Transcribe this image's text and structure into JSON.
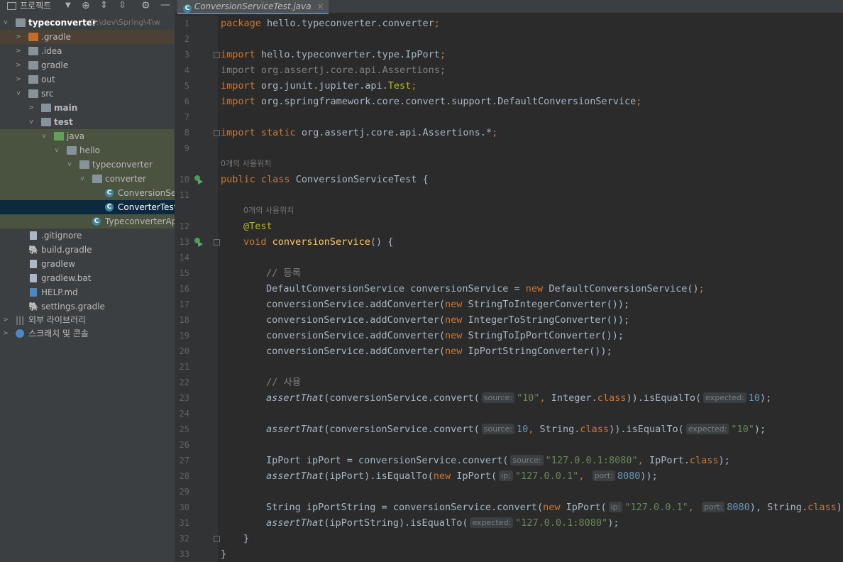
{
  "toolbar": {
    "project_label": "프로젝트"
  },
  "tab": {
    "label": "ConversionServiceTest.java"
  },
  "tree": [
    {
      "label": "typeconverter",
      "path": "D:\\dev\\Spring\\4\\w",
      "depth": 0,
      "arrow": "v",
      "icon": "module"
    },
    {
      "label": ".gradle",
      "depth": 1,
      "arrow": ">",
      "icon": "folder-orange"
    },
    {
      "label": ".idea",
      "depth": 1,
      "arrow": ">",
      "icon": "folder"
    },
    {
      "label": "gradle",
      "depth": 1,
      "arrow": ">",
      "icon": "folder"
    },
    {
      "label": "out",
      "depth": 1,
      "arrow": ">",
      "icon": "folder"
    },
    {
      "label": "src",
      "depth": 1,
      "arrow": "v",
      "icon": "folder"
    },
    {
      "label": "main",
      "depth": 2,
      "arrow": ">",
      "icon": "folder"
    },
    {
      "label": "test",
      "depth": 2,
      "arrow": "v",
      "icon": "folder"
    },
    {
      "label": "java",
      "depth": 3,
      "arrow": "v",
      "icon": "folder-green"
    },
    {
      "label": "hello",
      "depth": 4,
      "arrow": "v",
      "icon": "package"
    },
    {
      "label": "typeconverter",
      "depth": 5,
      "arrow": "v",
      "icon": "package"
    },
    {
      "label": "converter",
      "depth": 6,
      "arrow": "v",
      "icon": "package"
    },
    {
      "label": "ConversionServ",
      "depth": 7,
      "arrow": "",
      "icon": "class"
    },
    {
      "label": "ConverterTest",
      "depth": 7,
      "arrow": "",
      "icon": "class"
    },
    {
      "label": "TypeconverterApp",
      "depth": 6,
      "arrow": "",
      "icon": "class"
    },
    {
      "label": ".gitignore",
      "depth": 1,
      "arrow": "",
      "icon": "file"
    },
    {
      "label": "build.gradle",
      "depth": 1,
      "arrow": "",
      "icon": "gradle-file"
    },
    {
      "label": "gradlew",
      "depth": 1,
      "arrow": "",
      "icon": "file"
    },
    {
      "label": "gradlew.bat",
      "depth": 1,
      "arrow": "",
      "icon": "file"
    },
    {
      "label": "HELP.md",
      "depth": 1,
      "arrow": "",
      "icon": "md-file"
    },
    {
      "label": "settings.gradle",
      "depth": 1,
      "arrow": "",
      "icon": "gradle-file"
    },
    {
      "label": "외부 라이브러리",
      "depth": 0,
      "arrow": ">",
      "icon": "library"
    },
    {
      "label": "스크래치 및 콘솔",
      "depth": 0,
      "arrow": ">",
      "icon": "scratch"
    }
  ],
  "hints": {
    "usages": "0개의 사용위치",
    "source": "source:",
    "expected": "expected:",
    "ip": "ip:",
    "port": "port:"
  },
  "code": {
    "line_numbers": [
      "1",
      "2",
      "3",
      "4",
      "5",
      "6",
      "7",
      "8",
      "9",
      "10",
      "11",
      "12",
      "13",
      "14",
      "15",
      "16",
      "17",
      "18",
      "19",
      "20",
      "21",
      "22",
      "23",
      "24",
      "25",
      "26",
      "27",
      "28",
      "29",
      "30",
      "31",
      "32",
      "33"
    ],
    "kw_package": "package",
    "pkg_name": "hello.typeconverter.converter",
    "kw_import": "import",
    "kw_static": "static",
    "imp_ipport": "hello.typeconverter.type.IpPort",
    "imp_assertions": "org.assertj.core.api.Assertions",
    "imp_junit": "org.junit.jupiter.api.",
    "imp_test": "Test",
    "imp_dcs": "org.springframework.core.convert.support.DefaultConversionService",
    "imp_static": "org.assertj.core.api.Assertions.*",
    "kw_public": "public",
    "kw_class": "class",
    "cls_name": "ConversionServiceTest",
    "ann_test": "@Test",
    "kw_void": "void",
    "method_name": "conversionService",
    "cmt_register": "// 등록",
    "dcs_type": "DefaultConversionService",
    "var_cs": "conversionService",
    "kw_new": "new",
    "dcs_ctor": "DefaultConversionService()",
    "add_conv": "conversionService.addConverter(",
    "conv_1": "StringToIntegerConverter());",
    "conv_2": "IntegerToStringConverter());",
    "conv_3": "StringToIpPortConverter());",
    "conv_4": "IpPortStringConverter());",
    "cmt_use": "// 사용",
    "fn_assert": "assertThat",
    "cs_convert": "(conversionService.convert(",
    "cs_convert2": "conversionService.convert(",
    "str_10": "\"10\"",
    "num_10": "10",
    "integer_cls": "Integer.",
    "string_cls": "String.",
    "ipport_cls": "IpPort.",
    "class_kw": "class",
    "is_equal_to": ".isEqualTo(",
    "close_paren": "))",
    "end_stmt": ");",
    "ipport_decl": "IpPort ipPort = ",
    "str_addr_port": "\"127.0.0.1:8080\"",
    "str_addr": "\"127.0.0.1\"",
    "num_8080": "8080",
    "assert_ipport_arg": "(ipPort)",
    "new_ipport": "IpPort(",
    "end_stmt2": "));",
    "string_decl": "String ipPortString = ",
    "assert_ipportstr_arg": "(ipPortString)",
    "brace_open": "{",
    "brace_close": "}",
    "paren_brace": "() {",
    "comma": ", "
  },
  "colors": {
    "editor_bg": "#2b2b2b",
    "keyword": "#cc7832",
    "string": "#6a8759",
    "number": "#6897bb",
    "annotation": "#bbb529",
    "method": "#ffc66d",
    "selection": "#0d293e"
  }
}
